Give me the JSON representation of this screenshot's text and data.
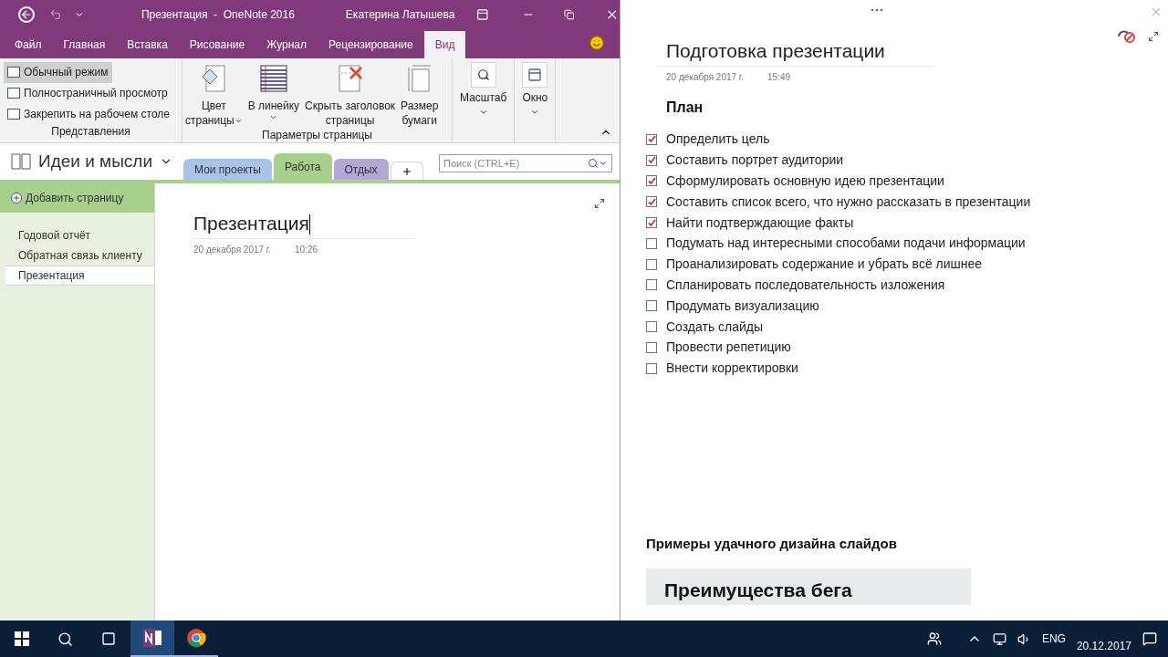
{
  "window": {
    "title": "Презентация  -  OneNote 2016",
    "user": "Екатерина Латышева"
  },
  "ribbon_tabs": [
    {
      "label": "Файл",
      "selected": false
    },
    {
      "label": "Главная",
      "selected": false
    },
    {
      "label": "Вставка",
      "selected": false
    },
    {
      "label": "Рисование",
      "selected": false
    },
    {
      "label": "Журнал",
      "selected": false
    },
    {
      "label": "Рецензирование",
      "selected": false
    },
    {
      "label": "Вид",
      "selected": true
    }
  ],
  "views": {
    "items": [
      {
        "label": "Обычный режим",
        "selected": true
      },
      {
        "label": "Полностраничный просмотр",
        "selected": false
      },
      {
        "label": "Закрепить на рабочем столе",
        "selected": false
      }
    ],
    "group_label": "Представления"
  },
  "page_options": {
    "buttons": [
      {
        "kind": "color",
        "lines": [
          "Цвет",
          "страницы"
        ],
        "dropdown": true
      },
      {
        "kind": "lines",
        "lines": [
          "В линейку"
        ],
        "dropdown": true
      },
      {
        "kind": "hide",
        "lines": [
          "Скрыть заголовок",
          "страницы"
        ],
        "dropdown": false
      },
      {
        "kind": "size",
        "lines": [
          "Размер",
          "бумаги"
        ],
        "dropdown": false
      }
    ],
    "group_label": "Параметры страницы"
  },
  "extra_buttons": [
    {
      "kind": "zoom",
      "label": "Масштаб"
    },
    {
      "kind": "window",
      "label": "Окно"
    }
  ],
  "notebook": {
    "name": "Идеи и мысли"
  },
  "section_tabs": [
    {
      "label": "Мои проекты",
      "selected": false,
      "color": "#a9c4e8"
    },
    {
      "label": "Работа",
      "selected": true,
      "color": "#a8d08d"
    },
    {
      "label": "Отдых",
      "selected": false,
      "color": "#b4a7d6"
    }
  ],
  "search": {
    "placeholder": "Поиск (CTRL+E)"
  },
  "add_page": "Добавить страницу",
  "pages": [
    {
      "label": "Годовой отчёт",
      "selected": false
    },
    {
      "label": "Обратная связь клиенту",
      "selected": false
    },
    {
      "label": "Презентация",
      "selected": true
    }
  ],
  "page": {
    "title": "Презентация",
    "date": "20 декабря 2017 г.",
    "time": "10:26"
  },
  "docked": {
    "title": "Подготовка презентации",
    "date": "20 декабря 2017 г.",
    "time": "15:49",
    "heading": "План",
    "tasks": [
      {
        "label": "Определить цель",
        "checked": true
      },
      {
        "label": "Составить портрет аудитории",
        "checked": true
      },
      {
        "label": "Сформулировать основную идею презентации",
        "checked": true
      },
      {
        "label": "Составить список всего, что нужно рассказать в презентации",
        "checked": true
      },
      {
        "label": "Найти подтверждающие факты",
        "checked": true
      },
      {
        "label": "Подумать над интересными способами подачи информации",
        "checked": false
      },
      {
        "label": "Проанализировать содержание и убрать всё лишнее",
        "checked": false
      },
      {
        "label": "Спланировать последовательность изложения",
        "checked": false
      },
      {
        "label": "Продумать визуализацию",
        "checked": false
      },
      {
        "label": "Создать слайды",
        "checked": false
      },
      {
        "label": "Провести репетицию",
        "checked": false
      },
      {
        "label": "Внести корректировки",
        "checked": false
      }
    ],
    "section_heading": "Примеры удачного дизайна слайдов",
    "slide_title": "Преимущества бега"
  },
  "taskbar": {
    "language": "ENG",
    "date": "20.12.2017"
  }
}
